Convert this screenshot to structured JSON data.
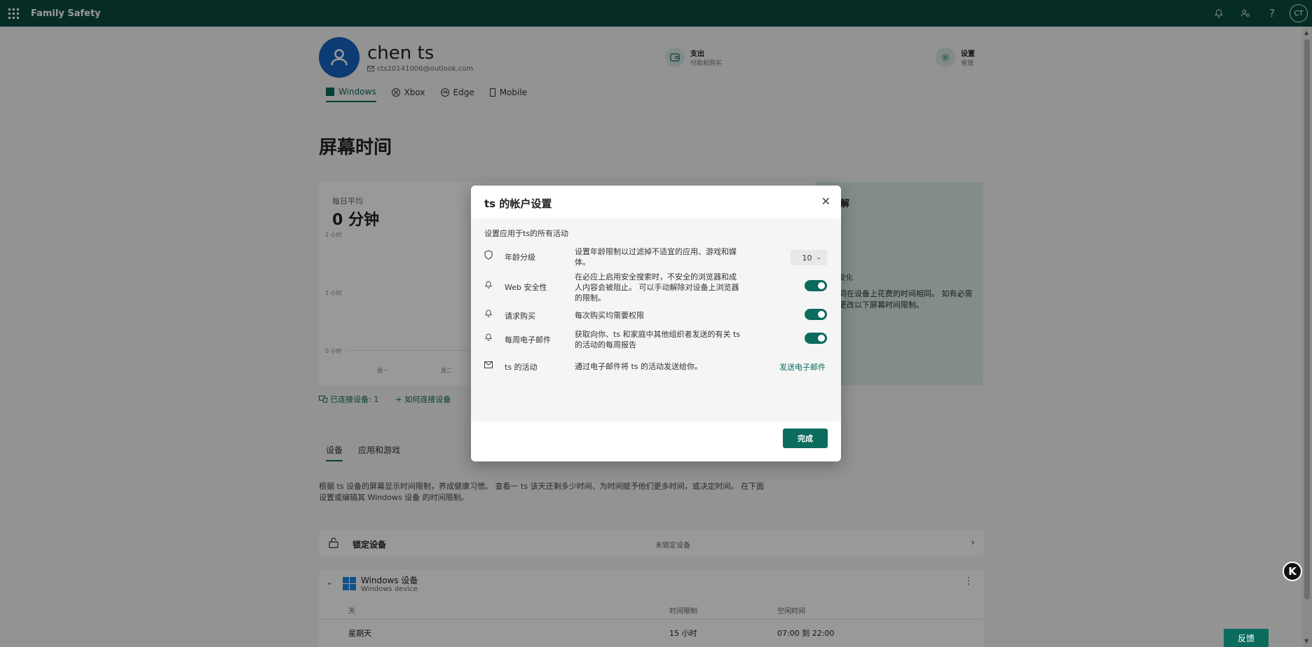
{
  "topbar": {
    "app_title": "Family Safety",
    "avatar_initials": "CT"
  },
  "profile": {
    "name": "chen ts",
    "email": "cts20141006@outlook.com"
  },
  "header_actions": {
    "spending": {
      "title": "支出",
      "sub": "付款和购买"
    },
    "settings": {
      "title": "设置",
      "sub": "管理"
    }
  },
  "device_tabs": [
    "Windows",
    "Xbox",
    "Edge",
    "Mobile"
  ],
  "screen_time": {
    "title": "屏幕时间",
    "avg_label": "每日平均",
    "avg_value": "0 分钟",
    "y_labels": [
      "2 小时",
      "1 小时",
      "0 小时"
    ],
    "x_labels": [
      "周一",
      "周二"
    ]
  },
  "side_card": {
    "title": "解",
    "sub": "变化",
    "text": "同在设备上花费的时间相同。 如有必需更改以下屏幕时间限制。"
  },
  "connected": {
    "devices": "已连接设备: 1",
    "how_to": "如何连接设备"
  },
  "lower_tabs": [
    "设备",
    "应用和游戏"
  ],
  "description": "根据 ts 设备的屏幕显示时间限制，养成健康习惯。 查看一 ts 该天还剩多少时间、为时间赋予他们更多时间，或决定时间。 在下面设置或编辑其 Windows 设备 的时间限制。",
  "lock_device": {
    "title": "锁定设备",
    "status": "未锁定设备"
  },
  "windows_device": {
    "title": "Windows 设备",
    "sub": "Windows device",
    "col_day": "天",
    "col_limit": "时间限制",
    "col_free": "空闲时间",
    "row_day": "星期天",
    "row_limit": "15 小时",
    "row_free": "07:00 到 22:00"
  },
  "feedback": "反馈",
  "dialog": {
    "title": "ts 的帐户设置",
    "subtitle": "设置应用于ts的所有活动",
    "rows": [
      {
        "label": "年龄分级",
        "desc": "设置年龄限制以过滤掉不适宜的应用、游戏和媒体。",
        "value": "10"
      },
      {
        "label": "Web 安全性",
        "desc": "在必应上启用安全搜索时，不安全的浏览器和成人内容会被阻止。 可以手动解除对设备上浏览器的限制。"
      },
      {
        "label": "请求购买",
        "desc": "每次购买均需要权限"
      },
      {
        "label": "每周电子邮件",
        "desc": "获取向你、ts 和家庭中其他组织者发送的有关 ts 的活动的每周报告"
      },
      {
        "label": "ts 的活动",
        "desc": "通过电子邮件将 ts 的活动发送给你。",
        "link": "发送电子邮件"
      }
    ],
    "done": "完成"
  },
  "colors": {
    "topbar": "#0b4a40",
    "accent": "#0b6b5c",
    "avatar": "#1565c0"
  }
}
